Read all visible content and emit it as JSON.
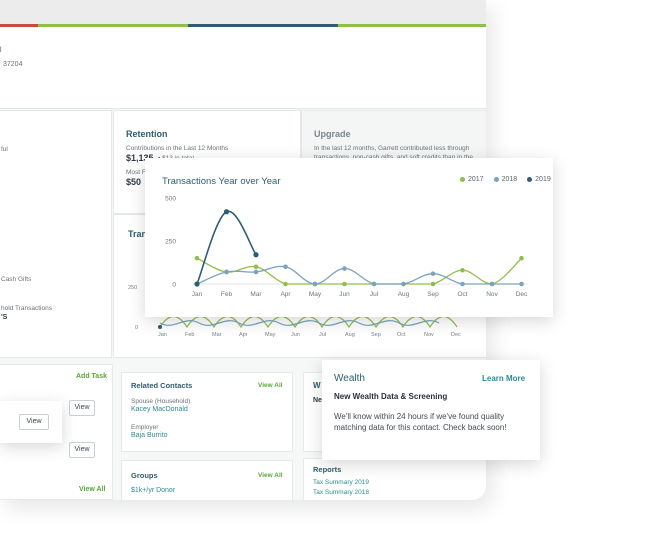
{
  "header": {
    "address_fragment": "37204",
    "address_prefix": "l"
  },
  "colors": {
    "series_2017": "#8fbf4a",
    "series_2018": "#7aa3bd",
    "series_2019": "#2e5e75",
    "stripe_1": "#c94b3f",
    "stripe_2": "#8fbf4a",
    "stripe_3": "#2e5e75",
    "stripe_4": "#8fbf4a"
  },
  "retention": {
    "title": "Retention",
    "contrib_label": "Contributions in the Last 12 Months",
    "contrib_value": "$1,135",
    "contrib_suffix": "• $13 in total",
    "most_label": "Most F",
    "most_value": "$50"
  },
  "upgrade": {
    "title": "Upgrade",
    "line1": "In the last 12 months, Garrett contributed less through",
    "line2": "transactions, non-cash gifts, and soft credits than in the"
  },
  "left_panel": {
    "text1": "ful",
    "text2": "Cash Gifts",
    "text3": "hold Transactions",
    "text4": "'S"
  },
  "transactions_bg": {
    "title_fragment": "Tran",
    "y_ticks": [
      "250",
      "0"
    ],
    "months": [
      "Jan",
      "Feb",
      "Mar",
      "Apr",
      "May",
      "Jun",
      "Jul",
      "Aug",
      "Sep",
      "Oct",
      "Nov",
      "Dec"
    ]
  },
  "tasks": {
    "add_task": "Add Task",
    "view_all": "View All",
    "view_label": "View"
  },
  "related_contacts": {
    "title": "Related Contacts",
    "view_all": "View All",
    "contact1_role": "Spouse (Household)",
    "contact1_name": "Kacey MacDonald",
    "contact2_role": "Employer",
    "contact2_name": "Baja Burrito"
  },
  "groups": {
    "title": "Groups",
    "view_all": "View All",
    "item1": "$1k+/yr Donor"
  },
  "wealth_bg": {
    "title_fragment": "W",
    "ne_fragment": "Ne"
  },
  "reports": {
    "title": "Reports",
    "item1": "Tax Summary 2019",
    "item2": "Tax Summary 2018"
  },
  "chart_card": {
    "title": "Transactions Year over Year",
    "legend": [
      "2017",
      "2018",
      "2019"
    ]
  },
  "chart_data": {
    "type": "line",
    "title": "Transactions Year over Year",
    "categories": [
      "Jan",
      "Feb",
      "Mar",
      "Apr",
      "May",
      "Jun",
      "Jul",
      "Aug",
      "Sep",
      "Oct",
      "Nov",
      "Dec"
    ],
    "y_ticks": [
      0,
      250,
      500
    ],
    "ylim": [
      0,
      500
    ],
    "series": [
      {
        "name": "2017",
        "values": [
          150,
          70,
          100,
          0,
          0,
          0,
          0,
          0,
          0,
          80,
          0,
          150
        ]
      },
      {
        "name": "2018",
        "values": [
          0,
          70,
          70,
          100,
          0,
          90,
          0,
          0,
          60,
          0,
          0,
          0
        ]
      },
      {
        "name": "2019",
        "values": [
          0,
          420,
          170,
          null,
          null,
          null,
          null,
          null,
          null,
          null,
          null,
          null
        ]
      }
    ],
    "legend_position": "top-right",
    "grid": false
  },
  "wealth_card": {
    "title": "Wealth",
    "learn_more": "Learn More",
    "subtitle": "New Wealth Data & Screening",
    "body": "We'll know within 24 hours if we've found quality matching data for this contact. Check back soon!"
  }
}
